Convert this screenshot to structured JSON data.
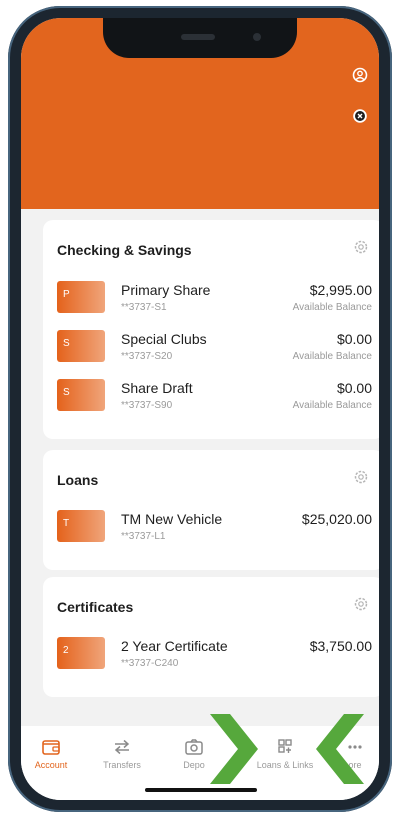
{
  "colors": {
    "brand": "#e2651e",
    "tab_active": "#e2651e",
    "tab_inactive": "#9a9a9a",
    "arrow_green": "#56a83c"
  },
  "header": {
    "icons": [
      "user-circle-icon",
      "close-circle-icon"
    ]
  },
  "sections": [
    {
      "title": "Checking & Savings",
      "accounts": [
        {
          "letter": "P",
          "name": "Primary Share",
          "number": "**3737-S1",
          "balance": "$2,995.00",
          "balance_label": "Available Balance"
        },
        {
          "letter": "S",
          "name": "Special Clubs",
          "number": "**3737-S20",
          "balance": "$0.00",
          "balance_label": "Available Balance"
        },
        {
          "letter": "S",
          "name": "Share Draft",
          "number": "**3737-S90",
          "balance": "$0.00",
          "balance_label": "Available Balance"
        }
      ]
    },
    {
      "title": "Loans",
      "accounts": [
        {
          "letter": "T",
          "name": "TM New Vehicle",
          "number": "**3737-L1",
          "balance": "$25,020.00"
        }
      ]
    },
    {
      "title": "Certificates",
      "accounts": [
        {
          "letter": "2",
          "name": "2 Year Certificate",
          "number": "**3737-C240",
          "balance": "$3,750.00"
        }
      ]
    }
  ],
  "tabs": [
    {
      "label": "Account",
      "icon": "wallet-icon",
      "active": true
    },
    {
      "label": "Transfers",
      "icon": "transfer-arrows-icon",
      "active": false
    },
    {
      "label": "Depo",
      "icon": "camera-icon",
      "active": false
    },
    {
      "label": "Loans & Links",
      "icon": "qr-grid-icon",
      "active": false
    },
    {
      "label": "ore",
      "icon": "more-dots-icon",
      "active": false
    }
  ]
}
